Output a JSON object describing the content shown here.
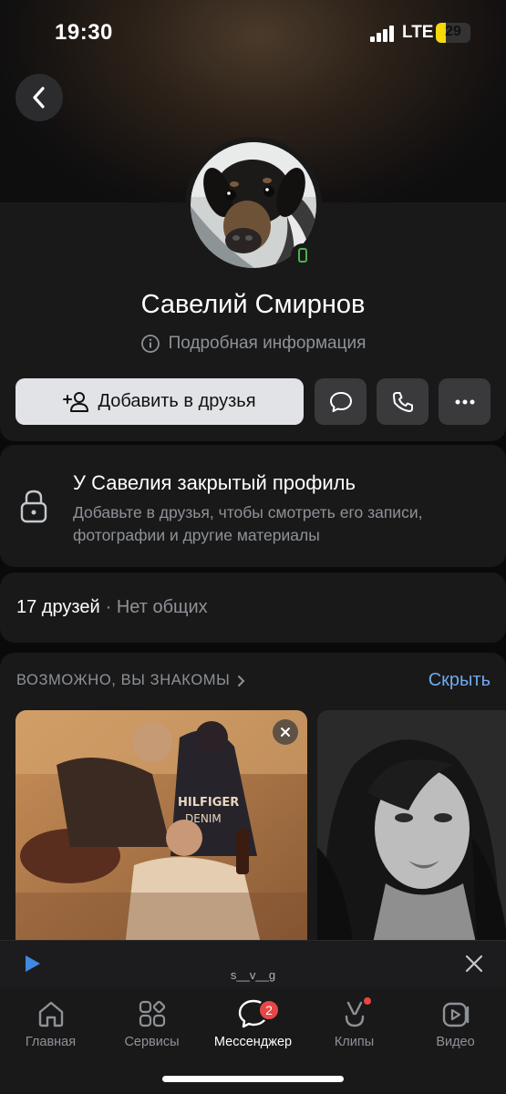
{
  "status_bar": {
    "time": "19:30",
    "network": "LTE",
    "battery": "29",
    "battery_level": 0.29
  },
  "profile": {
    "name": "Савелий Смирнов",
    "details_label": "Подробная информация",
    "online_status": "online-mobile"
  },
  "actions": {
    "add_friend_label": "Добавить в друзья",
    "message_icon": "chat-bubble-icon",
    "call_icon": "phone-icon",
    "more_icon": "more-dots-icon"
  },
  "closed_profile": {
    "title": "У Савелия закрытый профиль",
    "description": "Добавьте в друзья, чтобы смотреть его записи, фотографии и другие материалы"
  },
  "friends": {
    "count_label": "17 друзей",
    "mutual_label": "· Нет общих"
  },
  "suggestions": {
    "title": "ВОЗМОЖНО, ВЫ ЗНАКОМЫ",
    "hide_label": "Скрыть"
  },
  "player": {
    "track": "s__v__g"
  },
  "tabs": [
    {
      "label": "Главная",
      "icon": "home-icon"
    },
    {
      "label": "Сервисы",
      "icon": "services-icon"
    },
    {
      "label": "Мессенджер",
      "icon": "messenger-icon",
      "badge": "2"
    },
    {
      "label": "Клипы",
      "icon": "clips-icon"
    },
    {
      "label": "Видео",
      "icon": "video-icon"
    }
  ],
  "colors": {
    "accent": "#71aaeb",
    "online": "#4bb34b",
    "badge": "#e64646",
    "background": "#0a0a0a",
    "card": "#19191a"
  }
}
